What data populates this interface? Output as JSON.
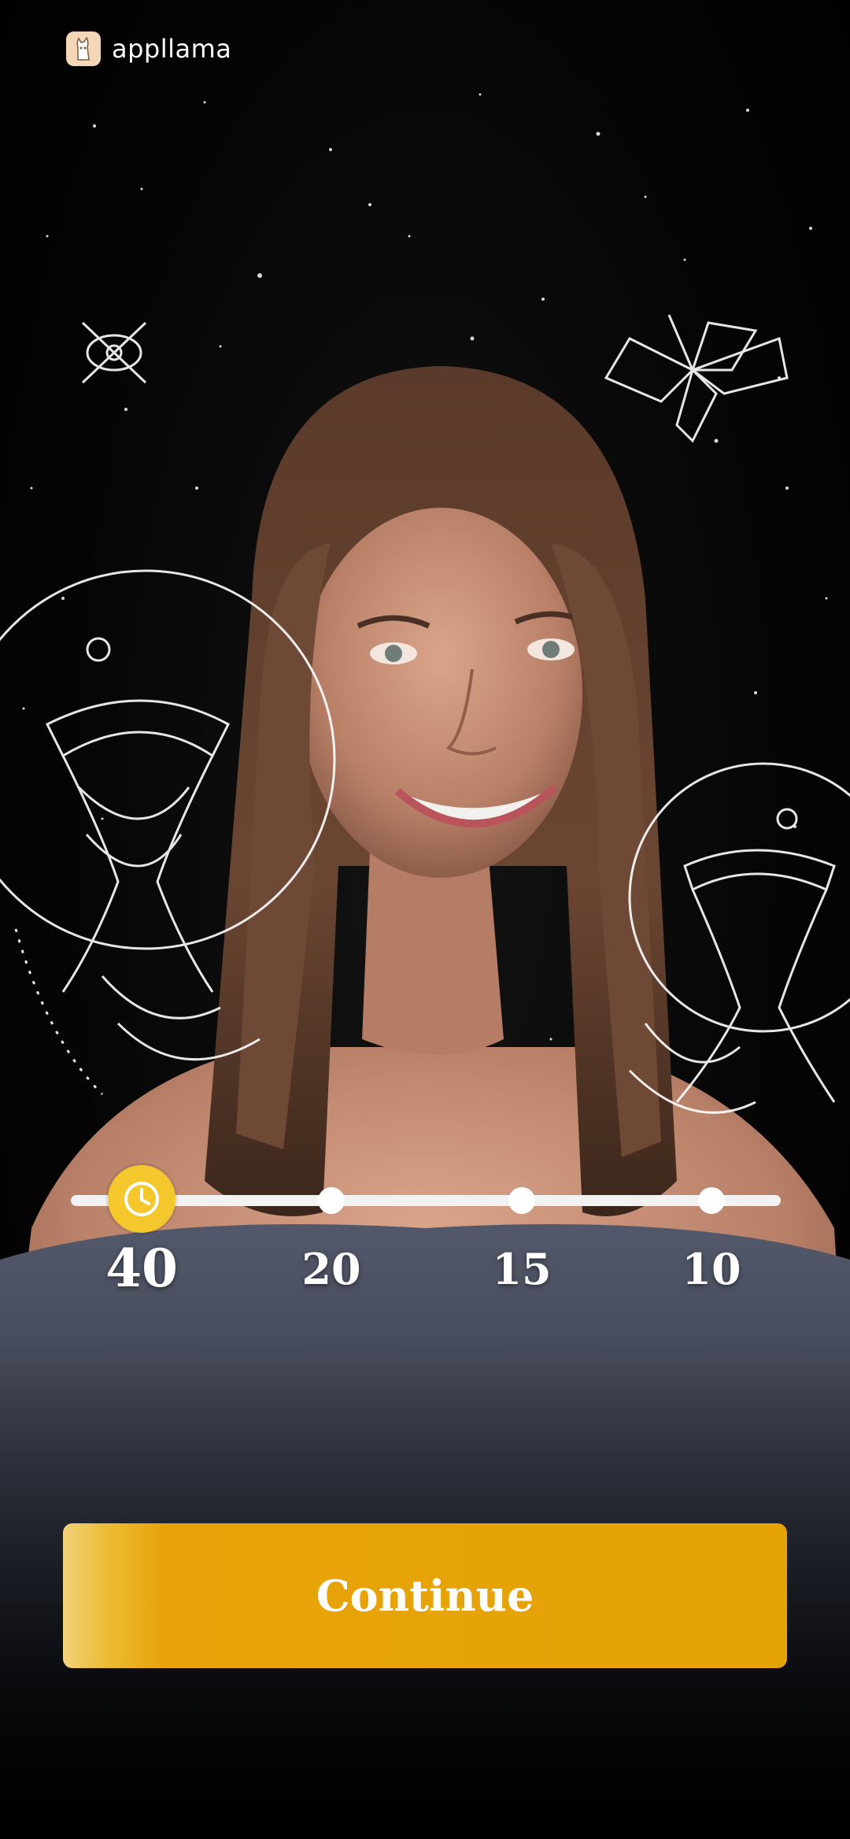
{
  "brand": {
    "name": "appllama",
    "logo_icon": "llama-icon"
  },
  "timeline": {
    "icon": "clock-icon",
    "selected": "40",
    "options": [
      {
        "label": "40"
      },
      {
        "label": "20"
      },
      {
        "label": "15"
      },
      {
        "label": "10"
      }
    ]
  },
  "actions": {
    "continue_label": "Continue"
  },
  "colors": {
    "accent": "#E6A305",
    "knob": "#F4C82C",
    "background": "#000000"
  }
}
